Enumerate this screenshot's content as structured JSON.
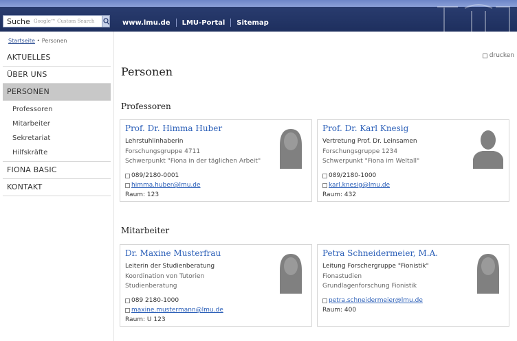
{
  "topbar": {
    "search_label": "Suche",
    "search_placeholder": "Google™ Custom Search",
    "links": [
      "www.lmu.de",
      "LMU-Portal",
      "Sitemap"
    ]
  },
  "breadcrumb": {
    "home": "Startseite",
    "separator": "•",
    "current": "Personen"
  },
  "sidebar": {
    "items": [
      {
        "label": "AKTUELLES"
      },
      {
        "label": "ÜBER UNS"
      },
      {
        "label": "PERSONEN",
        "active": true
      },
      {
        "label": "FIONA BASIC"
      },
      {
        "label": "KONTAKT"
      }
    ],
    "sub_items": [
      "Professoren",
      "Mitarbeiter",
      "Sekretariat",
      "Hilfskräfte"
    ]
  },
  "print_label": "drucken",
  "page_title": "Personen",
  "sections": [
    {
      "title": "Professoren",
      "people": [
        {
          "name": "Prof. Dr. Himma Huber",
          "role": "Lehrstuhlinhaberin",
          "lines": [
            "Forschungsgruppe 4711",
            "Schwerpunkt \"Fiona in der täglichen Arbeit\""
          ],
          "phone": "089/2180-0001",
          "email": "himma.huber@lmu.de",
          "room": "Raum: 123",
          "avatar": "female-silhouette-icon"
        },
        {
          "name": "Prof. Dr. Karl Knesig",
          "role": "Vertretung Prof. Dr. Leinsamen",
          "lines": [
            "Forschungsgruppe 1234",
            "Schwerpunkt \"Fiona im Weltall\""
          ],
          "phone": "089/2180-1000",
          "email": "karl.knesig@lmu.de",
          "room": "Raum: 432",
          "avatar": "male-silhouette-icon"
        }
      ]
    },
    {
      "title": "Mitarbeiter",
      "people": [
        {
          "name": "Dr. Maxine Musterfrau",
          "role": "Leiterin der Studienberatung",
          "lines": [
            "Koordination von Tutorien",
            "Studienberatung"
          ],
          "phone": "089 2180-1000",
          "email": "maxine.mustermann@lmu.de",
          "room": "Raum: U 123",
          "avatar": "female-silhouette-icon"
        },
        {
          "name": "Petra Schneidermeier, M.A.",
          "role": "Leitung Forschergruppe \"Fionistik\"",
          "lines": [
            "Fionastudien",
            "Grundlagenforschung Fionistik"
          ],
          "phone": "",
          "email": "petra.schneidermeier@lmu.de",
          "room": "Raum: 400",
          "avatar": "female-silhouette-icon"
        }
      ]
    }
  ],
  "colors": {
    "topbar": "#1e2f5e",
    "link": "#2b5fb8",
    "active_nav": "#c8c8c8"
  }
}
